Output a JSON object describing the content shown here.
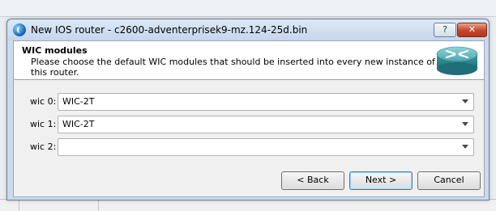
{
  "dialog": {
    "title": "New IOS router - c2600-adventerprisek9-mz.124-25d.bin",
    "help_label": "?",
    "close_label": "✕"
  },
  "header": {
    "title": "WIC modules",
    "subtitle": "Please choose the default WIC modules that should be inserted into every new instance of this router."
  },
  "wic_slots": [
    {
      "label": "wic 0:",
      "value": "WIC-2T"
    },
    {
      "label": "wic 1:",
      "value": "WIC-2T"
    },
    {
      "label": "wic 2:",
      "value": ""
    }
  ],
  "buttons": {
    "back": "< Back",
    "next": "Next >",
    "cancel": "Cancel"
  },
  "icons": {
    "app": "app-logo-icon",
    "router": "router-icon"
  }
}
